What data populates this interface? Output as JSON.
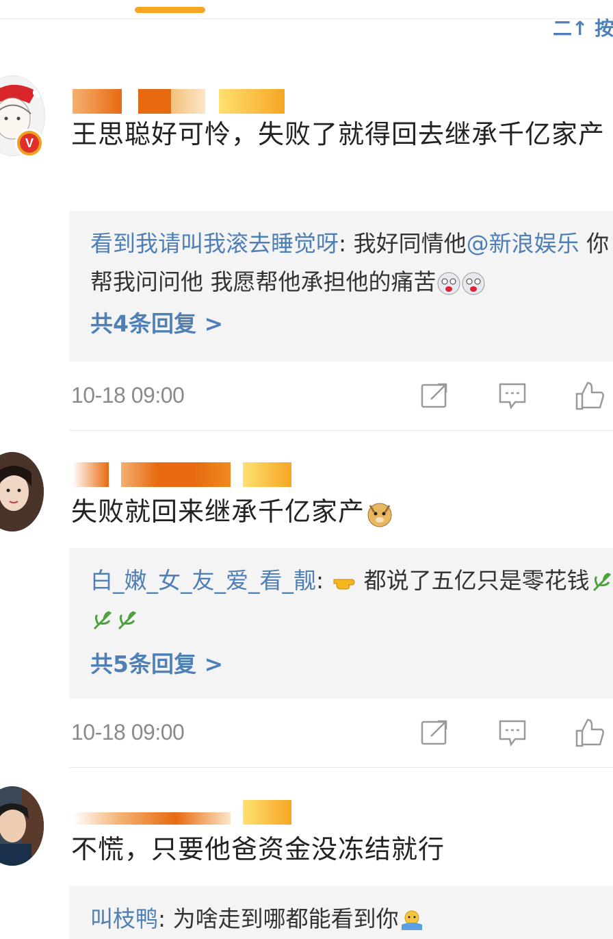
{
  "header": {
    "sort_label": "二↑ 按热"
  },
  "comments": [
    {
      "verified": true,
      "username_colors": [
        "#f08a20",
        "#e86a10",
        "#f5c07a",
        "#ffd03a",
        "#f5a623"
      ],
      "content": "王思聪好可怜，失败了就得回去继承千亿家产",
      "reply": {
        "user": "看到我请叫我滚去睡觉呀",
        "text_before_mention": ": 我好同情他",
        "mention": "@新浪娱乐",
        "text_after_mention": " 你帮我问问他 我愿帮他承担他的痛苦",
        "emojis": [
          "crying-face",
          "crying-face"
        ],
        "count_label": "共4条回复 >"
      },
      "timestamp": "10-18 09:00"
    },
    {
      "verified": false,
      "username_colors": [
        "#f08a20",
        "#e86a10",
        "#f3b070",
        "#ffd03a",
        "#f5a623"
      ],
      "content": "失败就回来继承千亿家产",
      "content_emoji": "doge",
      "reply": {
        "user": "白_嫩_女_友_爱_看_靓",
        "text_before_mention": ": ",
        "pointing_emoji": "pointing-hand",
        "text": "都说了五亿只是零花钱",
        "emojis": [
          "leaf",
          "leaf",
          "leaf"
        ],
        "count_label": "共5条回复 >"
      },
      "timestamp": "10-18 09:00"
    },
    {
      "verified": false,
      "username_colors": [
        "#f08a20",
        "#e86a10",
        "#f3b070",
        "#ffd03a",
        "#f5a623"
      ],
      "content": "不慌，只要他爸资金没冻结就行",
      "reply": {
        "user": "叫枝鸭",
        "text": ": 为啥走到哪都能看到你",
        "emojis": [
          "shrug"
        ]
      }
    }
  ]
}
